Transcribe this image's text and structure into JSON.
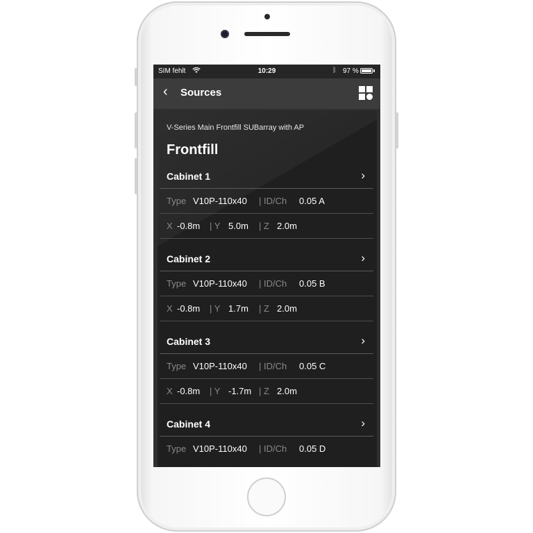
{
  "status_bar": {
    "carrier": "SIM fehlt",
    "time": "10:29",
    "battery": "97 %",
    "battery_level": 0.97
  },
  "nav": {
    "back_icon": "‹",
    "title": "Sources",
    "menu_icon": "grid-icon"
  },
  "group": {
    "subtitle": "V-Series Main Frontfill SUBarray with AP",
    "title": "Frontfill"
  },
  "labels": {
    "type": "Type",
    "idch": "| ID/Ch",
    "x": "X",
    "y": "| Y",
    "z": "| Z"
  },
  "cabinets": [
    {
      "name": "Cabinet 1",
      "type": "V10P-110x40",
      "id": "0.05 A",
      "x": "-0.8m",
      "y": "5.0m",
      "z": "2.0m"
    },
    {
      "name": "Cabinet 2",
      "type": "V10P-110x40",
      "id": "0.05 B",
      "x": "-0.8m",
      "y": "1.7m",
      "z": "2.0m"
    },
    {
      "name": "Cabinet 3",
      "type": "V10P-110x40",
      "id": "0.05 C",
      "x": "-0.8m",
      "y": "-1.7m",
      "z": "2.0m"
    },
    {
      "name": "Cabinet 4",
      "type": "V10P-110x40",
      "id": "0.05 D"
    }
  ],
  "colors": {
    "screen_bg": "#2f2f2f",
    "panel_bg": "#1f1f1f",
    "navbar_bg": "#3c3c3c"
  }
}
